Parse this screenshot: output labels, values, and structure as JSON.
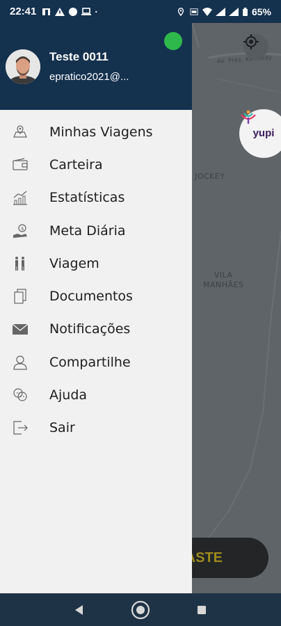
{
  "status_bar": {
    "time": "22:41",
    "battery": "65%"
  },
  "user": {
    "name": "Teste 0011",
    "email": "epratico2021@..."
  },
  "menu": {
    "items": [
      {
        "label": "Minhas Viagens",
        "icon": "trips-icon"
      },
      {
        "label": "Carteira",
        "icon": "wallet-icon"
      },
      {
        "label": "Estatísticas",
        "icon": "chart-icon"
      },
      {
        "label": "Meta Diária",
        "icon": "goal-icon"
      },
      {
        "label": "Viagem",
        "icon": "travel-icon"
      },
      {
        "label": "Documentos",
        "icon": "documents-icon"
      },
      {
        "label": "Notificações",
        "icon": "envelope-icon"
      },
      {
        "label": "Compartilhe",
        "icon": "user-share-icon"
      },
      {
        "label": "Ajuda",
        "icon": "help-icon"
      },
      {
        "label": "Sair",
        "icon": "logout-icon"
      }
    ]
  },
  "map": {
    "labels": {
      "jockey": "JOCKEY",
      "vila": "VILA\nMANHÃES",
      "road": "Av. Pres. Kennedy"
    },
    "brand": "yupi",
    "action_button_visible_text": "ASTE"
  },
  "colors": {
    "header": "#14314e",
    "online": "#2eb84b",
    "drawer_bg": "#f1f1f1"
  }
}
